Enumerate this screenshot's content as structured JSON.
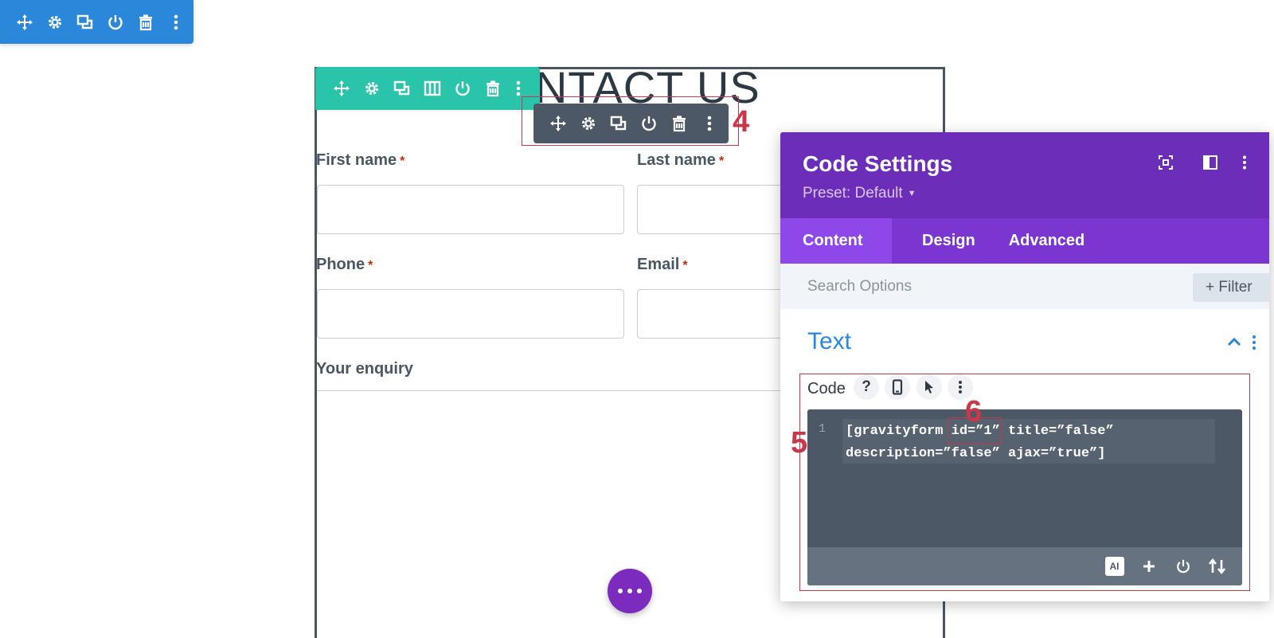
{
  "heading": {
    "text": "ONTACT US"
  },
  "form": {
    "first_name_label": "First name",
    "last_name_label": "Last name",
    "phone_label": "Phone",
    "email_label": "Email",
    "enquiry_label": "Your enquiry",
    "required_mark": "*"
  },
  "annotations": {
    "n4": "4",
    "n5": "5",
    "n6": "6"
  },
  "panel": {
    "title": "Code Settings",
    "preset": "Preset: Default",
    "tabs": [
      {
        "label": "Content",
        "active": true
      },
      {
        "label": "Design",
        "active": false
      },
      {
        "label": "Advanced",
        "active": false
      }
    ],
    "search_placeholder": "Search Options",
    "filter_label": "+ Filter",
    "section_title": "Text",
    "code_label": "Code",
    "help_glyph": "?",
    "editor": {
      "line_number": "1",
      "code": "[gravityform id=”1” title=”false” description=”false” ajax=”true”]"
    },
    "ai_badge": "AI"
  },
  "colors": {
    "section_toolbar": "#2b87da",
    "row_toolbar": "#29c4a9",
    "module_toolbar": "#4c5866",
    "panel_header": "#6c2eb9",
    "annotation": "#c8374a"
  }
}
